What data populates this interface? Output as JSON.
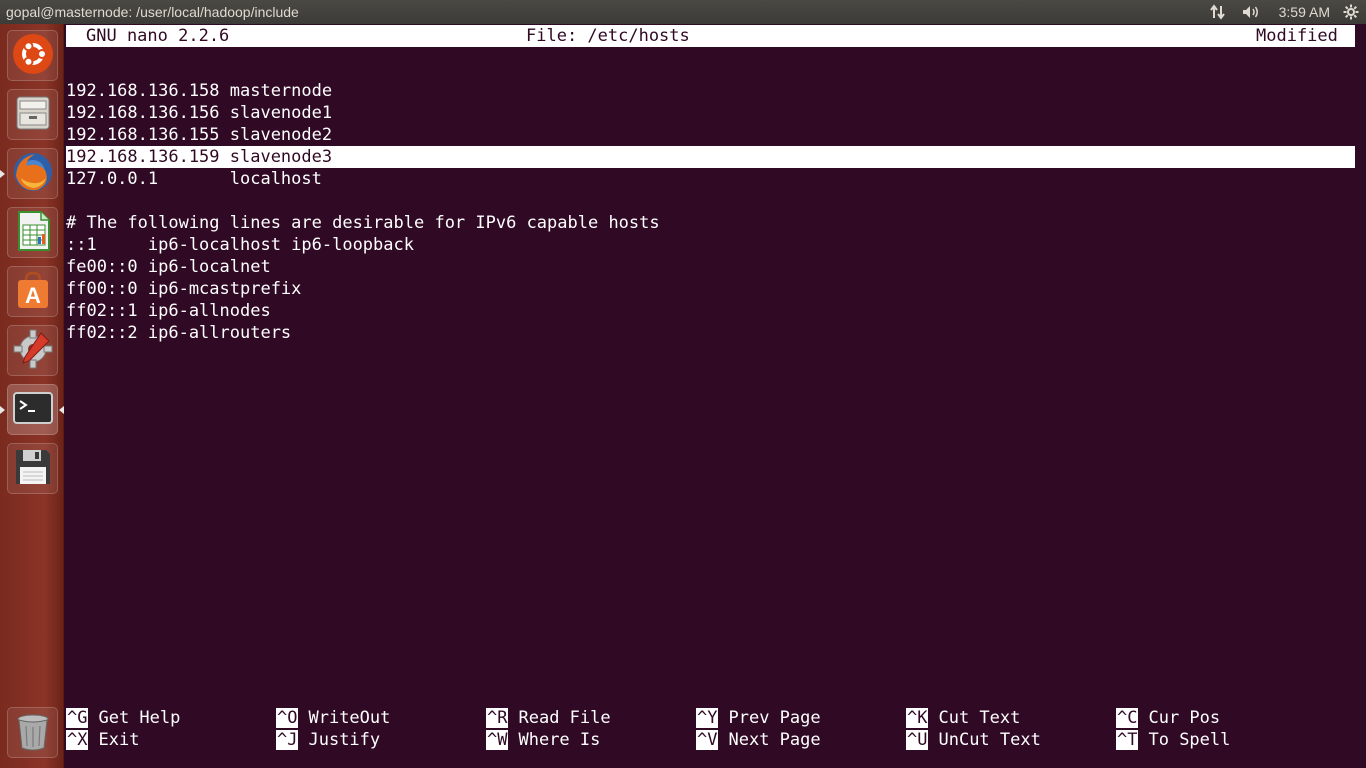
{
  "window": {
    "title": "gopal@masternode: /user/local/hadoop/include",
    "clock": "3:59 AM"
  },
  "launcher": {
    "items": [
      {
        "name": "ubuntu-dash-icon"
      },
      {
        "name": "files-icon"
      },
      {
        "name": "firefox-icon"
      },
      {
        "name": "libreoffice-calc-icon"
      },
      {
        "name": "software-center-icon"
      },
      {
        "name": "system-settings-icon"
      },
      {
        "name": "terminal-icon"
      },
      {
        "name": "floppy-disk-icon"
      },
      {
        "name": "trash-icon"
      }
    ]
  },
  "nano": {
    "version": "GNU nano 2.2.6",
    "file": "File: /etc/hosts",
    "status": "Modified",
    "lines": [
      "",
      "192.168.136.158 masternode",
      "192.168.136.156 slavenode1",
      "192.168.136.155 slavenode2",
      "192.168.136.159 slavenode3",
      "127.0.0.1       localhost",
      "",
      "# The following lines are desirable for IPv6 capable hosts",
      "::1     ip6-localhost ip6-loopback",
      "fe00::0 ip6-localnet",
      "ff00::0 ip6-mcastprefix",
      "ff02::1 ip6-allnodes",
      "ff02::2 ip6-allrouters"
    ],
    "highlighted_line": 4,
    "shortcuts": [
      [
        {
          "key": "^G",
          "label": "Get Help"
        },
        {
          "key": "^O",
          "label": "WriteOut"
        },
        {
          "key": "^R",
          "label": "Read File"
        },
        {
          "key": "^Y",
          "label": "Prev Page"
        },
        {
          "key": "^K",
          "label": "Cut Text"
        },
        {
          "key": "^C",
          "label": "Cur Pos"
        }
      ],
      [
        {
          "key": "^X",
          "label": "Exit"
        },
        {
          "key": "^J",
          "label": "Justify"
        },
        {
          "key": "^W",
          "label": "Where Is"
        },
        {
          "key": "^V",
          "label": "Next Page"
        },
        {
          "key": "^U",
          "label": "UnCut Text"
        },
        {
          "key": "^T",
          "label": "To Spell"
        }
      ]
    ]
  }
}
